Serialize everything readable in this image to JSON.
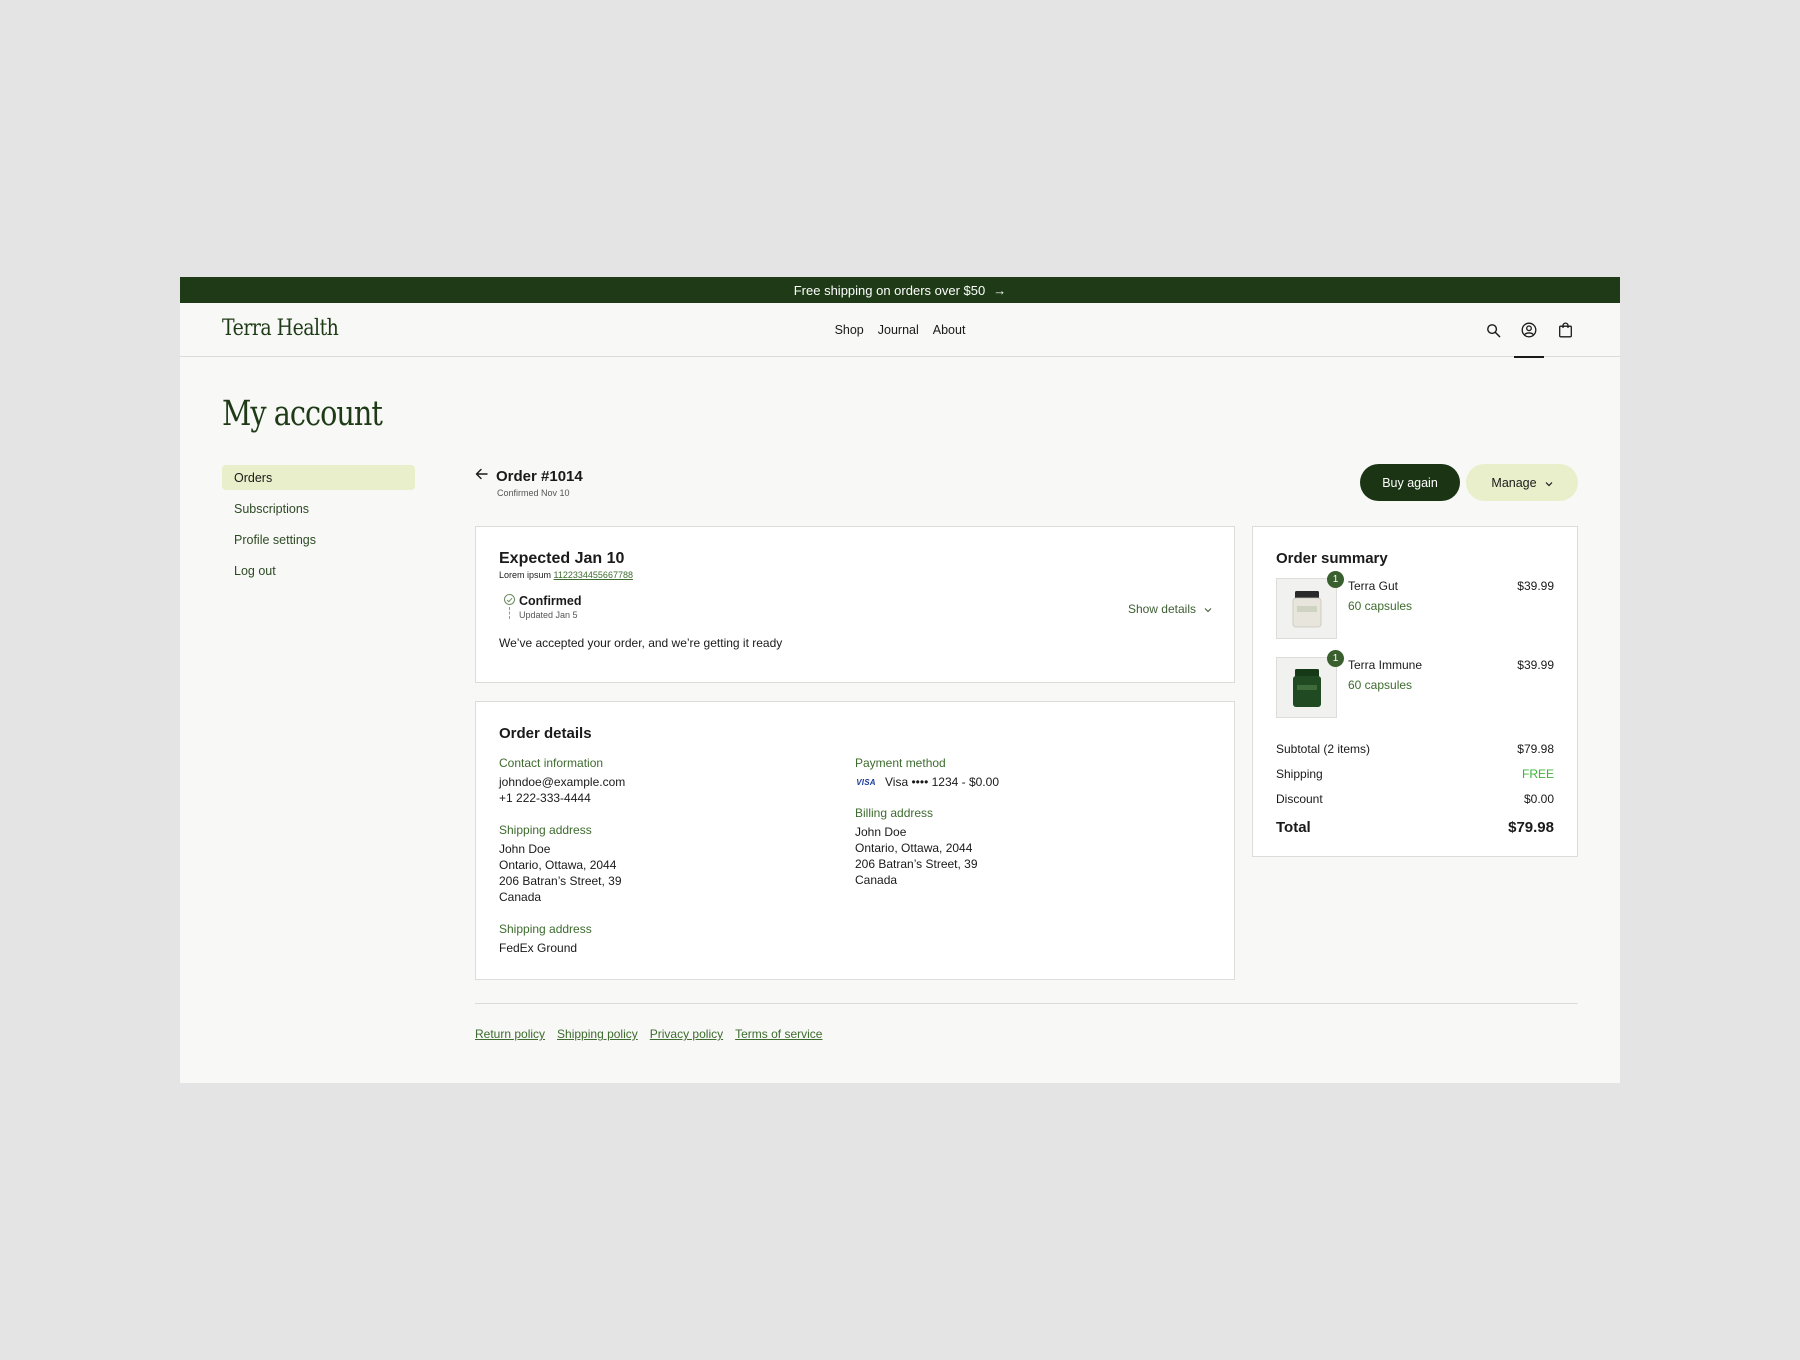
{
  "announcement": {
    "text": "Free shipping on orders over $50"
  },
  "header": {
    "logo": "Terra Health",
    "nav": [
      "Shop",
      "Journal",
      "About"
    ]
  },
  "page": {
    "title": "My account"
  },
  "sidebar": {
    "items": [
      {
        "label": "Orders",
        "active": true
      },
      {
        "label": "Subscriptions"
      },
      {
        "label": "Profile settings"
      },
      {
        "label": "Log out"
      }
    ]
  },
  "order": {
    "id": "Order #1014",
    "confirmed": "Confirmed Nov 10",
    "buy_again": "Buy again",
    "manage": "Manage"
  },
  "status_card": {
    "expected": "Expected Jan 10",
    "tracking_prefix": "Lorem ipsum",
    "tracking_number": "1122334455667788",
    "status": "Confirmed",
    "updated": "Updated Jan 5",
    "show_details": "Show details",
    "message": "We’ve accepted your order, and we’re getting it ready"
  },
  "details": {
    "title": "Order details",
    "contact": {
      "label": "Contact information",
      "email": "johndoe@example.com",
      "phone": "+1 222-333-4444"
    },
    "payment": {
      "label": "Payment method",
      "brand": "VISA",
      "text": "Visa •••• 1234 - $0.00"
    },
    "shipping_address": {
      "label": "Shipping address",
      "lines": [
        "John Doe",
        "Ontario, Ottawa, 2044",
        "206 Batran’s Street, 39",
        "Canada"
      ]
    },
    "billing_address": {
      "label": "Billing address",
      "lines": [
        "John Doe",
        "Ontario, Ottawa, 2044",
        "206 Batran’s Street, 39",
        "Canada"
      ]
    },
    "shipping_method": {
      "label": "Shipping address",
      "value": "FedEx Ground"
    }
  },
  "summary": {
    "title": "Order summary",
    "products": [
      {
        "qty": "1",
        "name": "Terra Gut",
        "variant": "60 capsules",
        "price": "$39.99",
        "jar_color": "#e8e6dc"
      },
      {
        "qty": "1",
        "name": "Terra Immune",
        "variant": "60 capsules",
        "price": "$39.99",
        "jar_color": "#1f4a22"
      }
    ],
    "rows": [
      {
        "label": "Subtotal (2 items)",
        "value": "$79.98"
      },
      {
        "label": "Shipping",
        "value": "FREE"
      },
      {
        "label": "Discount",
        "value": "$0.00"
      }
    ],
    "total": {
      "label": "Total",
      "value": "$79.98"
    }
  },
  "footer": {
    "links": [
      "Return policy",
      "Shipping policy",
      "Privacy policy",
      "Terms of service"
    ]
  },
  "colors": {
    "brand_dark": "#1e3a16",
    "accent_light": "#e9efcb",
    "link_green": "#3e6b2e",
    "free_green": "#3db53a"
  }
}
